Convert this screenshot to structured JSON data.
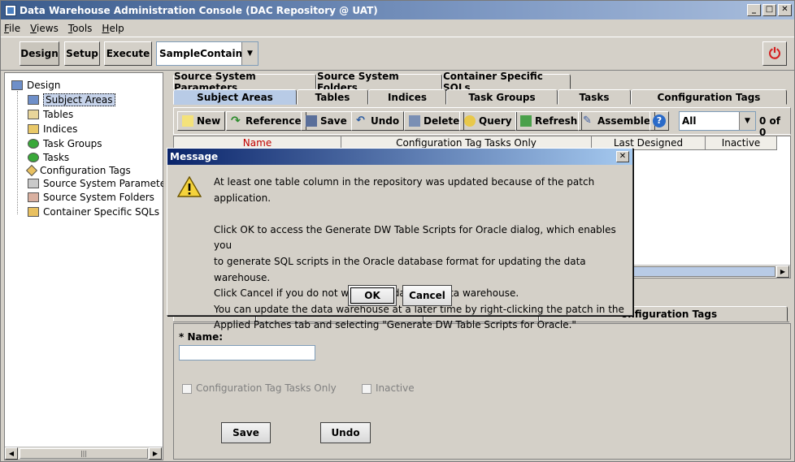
{
  "window": {
    "title": "Data Warehouse Administration Console (DAC Repository @ UAT)"
  },
  "menu": [
    "File",
    "Views",
    "Tools",
    "Help"
  ],
  "toolbar": {
    "design": "Design",
    "setup": "Setup",
    "execute": "Execute",
    "container": "SampleContainer"
  },
  "tree": {
    "root": "Design",
    "items": [
      "Subject Areas",
      "Tables",
      "Indices",
      "Task Groups",
      "Tasks",
      "Configuration Tags",
      "Source System Parameters",
      "Source System Folders",
      "Container Specific SQLs"
    ],
    "selected": "Subject Areas"
  },
  "tabs_top": [
    "Source System Parameters",
    "Source System Folders",
    "Container Specific SQLs"
  ],
  "tabs_bottom": [
    "Subject Areas",
    "Tables",
    "Indices",
    "Task Groups",
    "Tasks",
    "Configuration Tags"
  ],
  "actions": {
    "new": "New",
    "reference": "Reference",
    "save": "Save",
    "undo": "Undo",
    "delete": "Delete",
    "query": "Query",
    "refresh": "Refresh",
    "assemble": "Assemble",
    "help": "?",
    "filter": "All",
    "count": "0 of 0"
  },
  "grid": {
    "columns": [
      "Name",
      "Configuration Tag Tasks Only",
      "Last Designed",
      "Inactive"
    ]
  },
  "detail": {
    "visible_tab_fragment": "onfiguration Tags",
    "name_label": "* Name:",
    "config_only_label": "Configuration Tag Tasks Only",
    "inactive_label": "Inactive",
    "save": "Save",
    "undo": "Undo"
  },
  "dialog": {
    "title": "Message",
    "lines": [
      "At least one table column in the repository was updated because of the patch application.",
      "",
      "Click OK to access the Generate DW Table Scripts for Oracle dialog, which enables you",
      "to generate SQL scripts in the Oracle database format for updating the data warehouse.",
      "Click Cancel if you do not want to update the data warehouse.",
      "You can update the data warehouse at a later time by right-clicking the patch in the",
      "Applied Patches tab and selecting \"Generate DW Table Scripts for Oracle.\""
    ],
    "ok": "OK",
    "cancel": "Cancel"
  },
  "colors": {
    "title_bar": "#3a5b8c",
    "dialog_title": "#0a246a",
    "active_tab": "#b8cbe6",
    "name_header": "#c00000"
  }
}
